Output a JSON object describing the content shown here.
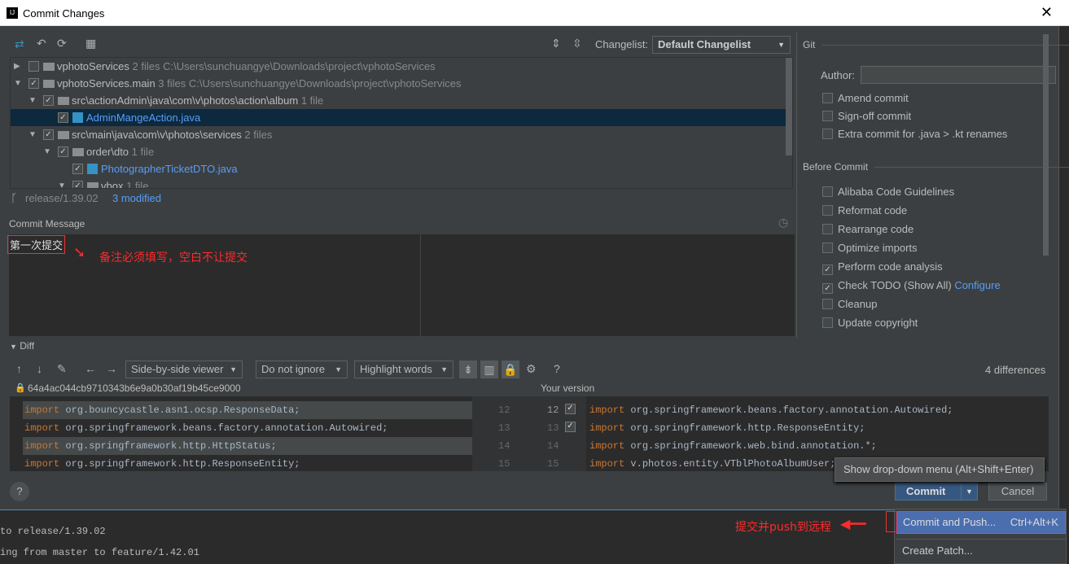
{
  "window": {
    "title": "Commit Changes",
    "close": "✕"
  },
  "toolbar": {
    "changelist_label": "Changelist:",
    "changelist_value": "Default Changelist"
  },
  "tree": {
    "rows": [
      {
        "name": "vphotoServices",
        "info": "2 files",
        "path": "C:\\Users\\sunchuangye\\Downloads\\project\\vphotoServices"
      },
      {
        "name": "vphotoServices.main",
        "info": "3 files",
        "path": "C:\\Users\\sunchuangye\\Downloads\\project\\vphotoServices"
      },
      {
        "name": "src\\actionAdmin\\java\\com\\v\\photos\\action\\album",
        "info": "1 file"
      },
      {
        "name": "AdminMangeAction.java"
      },
      {
        "name": "src\\main\\java\\com\\v\\photos\\services",
        "info": "2 files"
      },
      {
        "name": "order\\dto",
        "info": "1 file"
      },
      {
        "name": "PhotographerTicketDTO.java"
      },
      {
        "name": "vbox",
        "info": "1 file"
      }
    ]
  },
  "status": {
    "branch": "release/1.39.02",
    "modified": "3 modified"
  },
  "commit_message": {
    "label": "Commit Message",
    "value": "第一次提交",
    "annotation": "备注必须填写，空白不让提交"
  },
  "git": {
    "title": "Git",
    "author_label": "Author:",
    "author_value": "",
    "options": [
      {
        "label": "Amend commit",
        "checked": false
      },
      {
        "label": "Sign-off commit",
        "checked": false
      },
      {
        "label": "Extra commit for .java > .kt renames",
        "checked": false
      }
    ]
  },
  "before_commit": {
    "title": "Before Commit",
    "options": [
      {
        "label": "Alibaba Code Guidelines",
        "checked": false
      },
      {
        "label": "Reformat code",
        "checked": false
      },
      {
        "label": "Rearrange code",
        "checked": false
      },
      {
        "label": "Optimize imports",
        "checked": false
      },
      {
        "label": "Perform code analysis",
        "checked": true
      },
      {
        "label": "Check TODO (Show All)",
        "checked": true,
        "link": "Configure"
      },
      {
        "label": "Cleanup",
        "checked": false
      },
      {
        "label": "Update copyright",
        "checked": false
      }
    ]
  },
  "diff": {
    "label": "Diff",
    "viewer": "Side-by-side viewer",
    "ignore": "Do not ignore",
    "highlight": "Highlight words",
    "help": "?",
    "differences": "4 differences",
    "left_revision": "64a4ac044cb9710343b6e9a0b30af19b45ce9000",
    "right_title": "Your version",
    "left_lines": [
      {
        "num": "12",
        "kw": "import",
        "text": " org.bouncycastle.asn1.ocsp.ResponseData;"
      },
      {
        "num": "13",
        "kw": "import",
        "text": " org.springframework.beans.factory.annotation.Autowired;"
      },
      {
        "num": "14",
        "kw": "import",
        "text": " org.springframework.http.HttpStatus;"
      },
      {
        "num": "15",
        "kw": "import",
        "text": " org.springframework.http.ResponseEntity;"
      }
    ],
    "right_nums": [
      "12",
      "13",
      "14",
      "15"
    ],
    "right_lines": [
      {
        "kw": "import",
        "text": " org.springframework.beans.factory.annotation.Autowired;"
      },
      {
        "kw": "import",
        "text": " org.springframework.http.ResponseEntity;"
      },
      {
        "kw": "import",
        "text": " org.springframework.web.bind.annotation.*;"
      },
      {
        "kw": "import",
        "text": " v.photos.entity.VTblPhotoAlbumUser;"
      }
    ]
  },
  "buttons": {
    "commit": "Commit",
    "cancel": "Cancel",
    "help": "?"
  },
  "tooltip": "Show drop-down menu (Alt+Shift+Enter)",
  "menu": {
    "items": [
      {
        "label": "Commit and Push...",
        "shortcut": "Ctrl+Alt+K"
      },
      {
        "label": "Create Patch..."
      }
    ],
    "annotation": "提交并push到远程"
  },
  "console": {
    "lines": [
      "to release/1.39.02",
      "ing from master to feature/1.42.01"
    ]
  },
  "colors": {
    "accent": "#365880",
    "selection": "#0d293e",
    "annotation": "#ff2a2a",
    "link": "#589df6"
  }
}
